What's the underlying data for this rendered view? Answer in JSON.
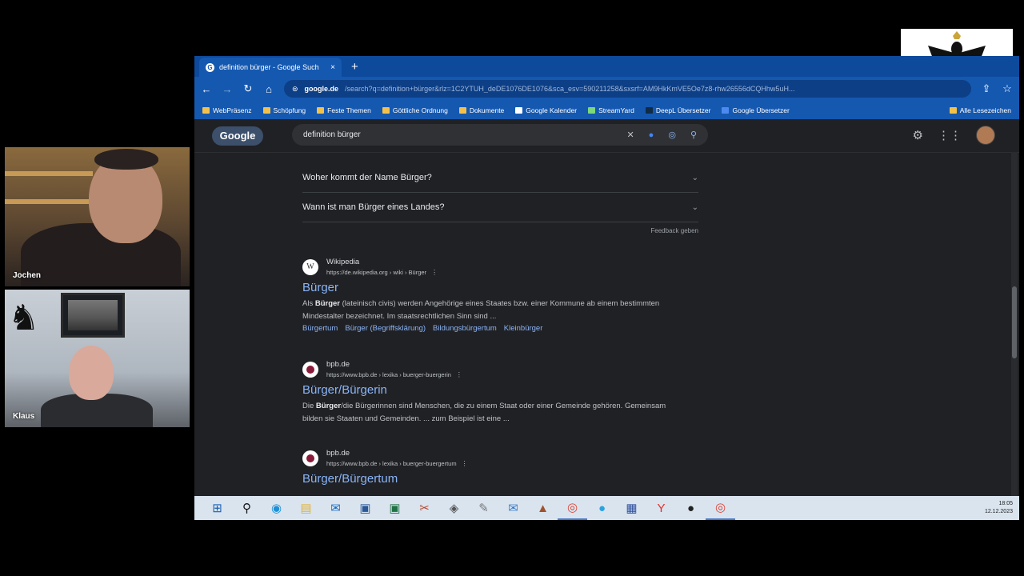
{
  "participants": [
    {
      "name": "Jochen"
    },
    {
      "name": "Klaus"
    }
  ],
  "browser": {
    "tab": {
      "title": "definition bürger - Google Such",
      "close": "×"
    },
    "new_tab": "+",
    "address": {
      "host": "google.de",
      "path": "/search?q=definition+bürger&rlz=1C2YTUH_deDE1076DE1076&sca_esv=590211258&sxsrf=AM9HkKmVE5Oe7z8-rhw26556dCQHhw5uH..."
    },
    "bookmarks": [
      "WebPräsenz",
      "Schöpfung",
      "Feste Themen",
      "Göttliche Ordnung",
      "Dokumente",
      "Google Kalender",
      "StreamYard",
      "DeepL Übersetzer",
      "Google Übersetzer"
    ],
    "all_bookmarks": "Alle Lesezeichen"
  },
  "google": {
    "logo": "Google",
    "query": "definition bürger",
    "faq": [
      "Woher kommt der Name Bürger?",
      "Wann ist man Bürger eines Landes?"
    ],
    "feedback": "Feedback geben",
    "results": [
      {
        "source": "Wikipedia",
        "url": "https://de.wikipedia.org › wiki › Bürger",
        "title": "Bürger",
        "snippet_pre": "Als ",
        "snippet_bold": "Bürger",
        "snippet_post": " (lateinisch civis) werden Angehörige eines Staates bzw. einer Kommune ab einem bestimmten Mindestalter bezeichnet. Im staatsrechtlichen Sinn sind ...",
        "links": [
          "Bürgertum",
          "Bürger (Begriffsklärung)",
          "Bildungsbürgertum",
          "Kleinbürger"
        ]
      },
      {
        "source": "bpb.de",
        "url": "https://www.bpb.de › lexika › buerger-buergerin",
        "title": "Bürger/Bürgerin",
        "snippet_pre": "Die ",
        "snippet_bold": "Bürger",
        "snippet_post": "/die Bürgerinnen sind Menschen, die zu einem Staat oder einer Gemeinde gehören. Gemeinsam bilden sie Staaten und Gemeinden. ... zum Beispiel ist eine ..."
      },
      {
        "source": "bpb.de",
        "url": "https://www.bpb.de › lexika › buerger-buergertum",
        "title": "Bürger/Bürgertum"
      }
    ]
  },
  "taskbar": {
    "time": "18:05",
    "date": "12.12.2023"
  }
}
